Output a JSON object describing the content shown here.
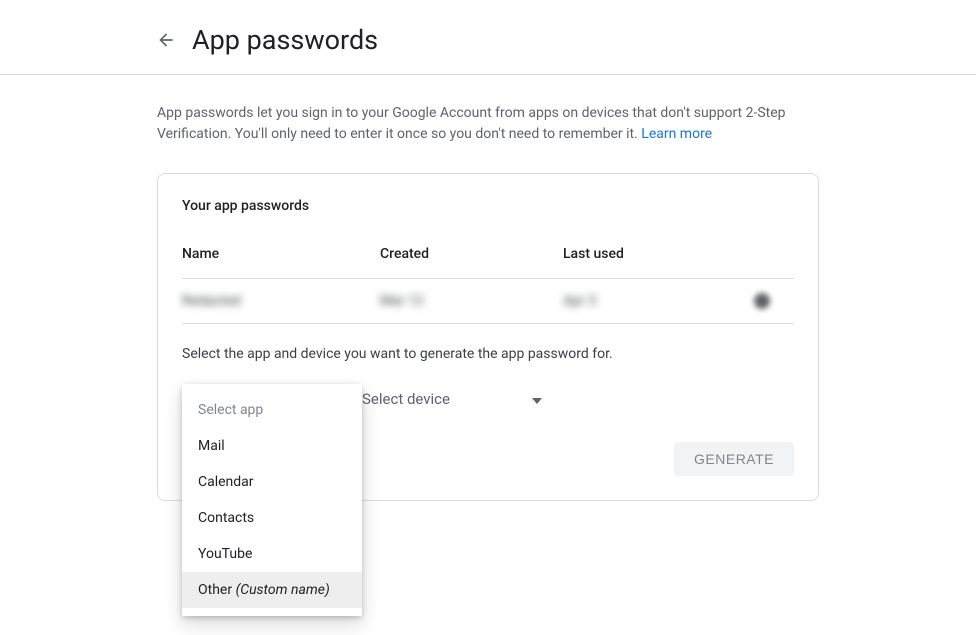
{
  "header": {
    "title": "App passwords"
  },
  "intro": {
    "text": "App passwords let you sign in to your Google Account from apps on devices that don't support 2-Step Verification. You'll only need to enter it once so you don't need to remember it. ",
    "learn_more": "Learn more"
  },
  "card": {
    "section_title": "Your app passwords",
    "columns": {
      "name": "Name",
      "created": "Created",
      "last_used": "Last used"
    },
    "row": {
      "name": "Redacted",
      "created": "Mar 12",
      "last_used": "Apr 3"
    },
    "select_instruction": "Select the app and device you want to generate the app password for.",
    "select_device_label": "Select device",
    "generate_label": "Generate"
  },
  "dropdown": {
    "placeholder": "Select app",
    "items": {
      "mail": "Mail",
      "calendar": "Calendar",
      "contacts": "Contacts",
      "youtube": "YouTube",
      "other_prefix": "Other ",
      "other_suffix": "(Custom name)"
    }
  }
}
